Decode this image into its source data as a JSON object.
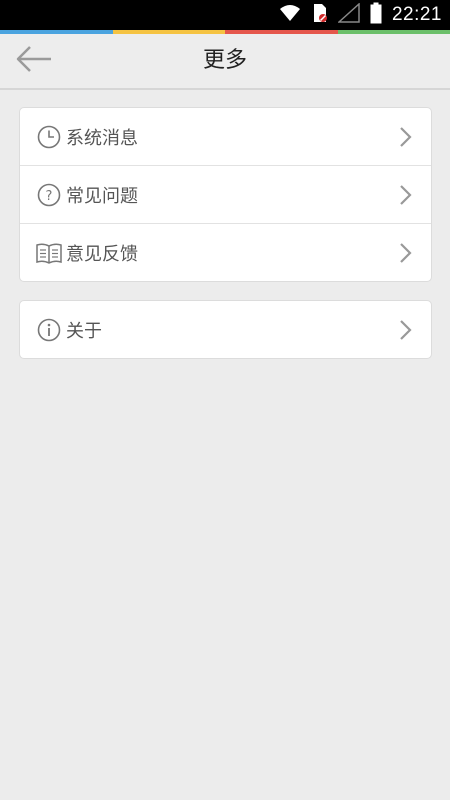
{
  "status_bar": {
    "time": "22:21",
    "icons": [
      "wifi-icon",
      "sim-card-icon",
      "cell-signal-icon",
      "battery-icon"
    ]
  },
  "color_strip": [
    "#4aa3df",
    "#f5c342",
    "#e5574c",
    "#6bbf6a"
  ],
  "header": {
    "title": "更多",
    "back_icon": "back-arrow-icon"
  },
  "menu_groups": [
    {
      "items": [
        {
          "label": "系统消息",
          "icon": "clock-icon"
        },
        {
          "label": "常见问题",
          "icon": "question-icon"
        },
        {
          "label": "意见反馈",
          "icon": "book-icon"
        }
      ]
    },
    {
      "items": [
        {
          "label": "关于",
          "icon": "info-icon"
        }
      ]
    }
  ],
  "colors": {
    "background": "#ececec",
    "card": "#ffffff",
    "icon_gray": "#777777",
    "chevron_gray": "#999999"
  }
}
